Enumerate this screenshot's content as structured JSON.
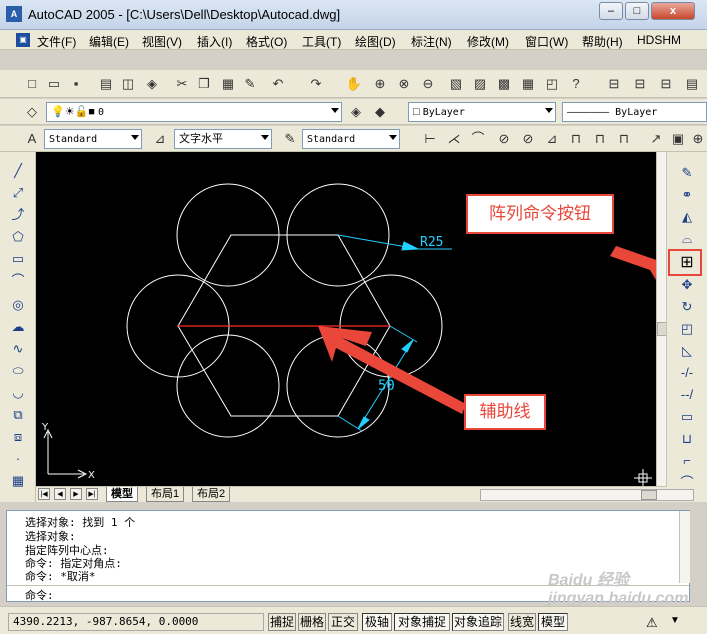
{
  "window": {
    "title": "AutoCAD 2005 - [C:\\Users\\Dell\\Desktop\\Autocad.dwg]",
    "app_icon": "AutoCAD",
    "minimize": "–",
    "maximize": "□",
    "close": "x"
  },
  "menu": [
    "文件(F)",
    "编辑(E)",
    "视图(V)",
    "插入(I)",
    "格式(O)",
    "工具(T)",
    "绘图(D)",
    "标注(N)",
    "修改(M)",
    "窗口(W)",
    "帮助(H)",
    "HDSHM"
  ],
  "toolbar": {
    "layer_value": "0",
    "color_value": "ByLayer",
    "linetype_value": "——————— ByLayer",
    "text_style": "Standard",
    "text_direction": "文字水平",
    "dim_style": "Standard"
  },
  "drawing": {
    "radius_label": "R25",
    "dim_label": "50",
    "ucs_x": "X",
    "ucs_y": "Y"
  },
  "annotations": {
    "array_button_label": "阵列命令按钮",
    "aux_line_label": "辅助线"
  },
  "layout_tabs": [
    "模型",
    "布局1",
    "布局2"
  ],
  "command_history": [
    "选择对象: 找到 1 个",
    "选择对象:",
    "指定阵列中心点:",
    "命令: 指定对角点:",
    "命令: *取消*"
  ],
  "command_prompt": "命令:",
  "status": {
    "coordinates": "4390.2213, -987.8654, 0.0000",
    "toggles": [
      "捕捉",
      "栅格",
      "正交",
      "极轴",
      "对象捕捉",
      "对象追踪",
      "线宽",
      "模型"
    ]
  },
  "watermark": "Baidu 经验 jingyan.baidu.com",
  "colors": {
    "canvas": "#000000",
    "geometry": "#ffffff",
    "aux_line": "#ff2a2a",
    "dimension": "#22d0ff",
    "callout": "#e8473a"
  }
}
